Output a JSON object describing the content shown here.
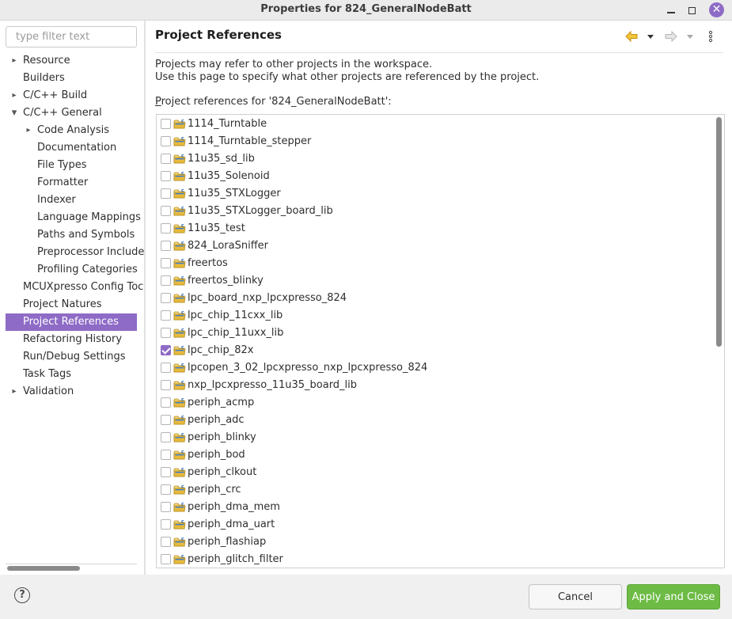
{
  "window": {
    "title": "Properties for 824_GeneralNodeBatt"
  },
  "left_panel": {
    "filter_placeholder": "type filter text",
    "tree": [
      {
        "label": "Resource",
        "level": 0,
        "expandable": true,
        "expanded": false
      },
      {
        "label": "Builders",
        "level": 0,
        "expandable": false
      },
      {
        "label": "C/C++ Build",
        "level": 0,
        "expandable": true,
        "expanded": false
      },
      {
        "label": "C/C++ General",
        "level": 0,
        "expandable": true,
        "expanded": true
      },
      {
        "label": "Code Analysis",
        "level": 1,
        "expandable": true,
        "expanded": false
      },
      {
        "label": "Documentation",
        "level": 1,
        "expandable": false
      },
      {
        "label": "File Types",
        "level": 1,
        "expandable": false
      },
      {
        "label": "Formatter",
        "level": 1,
        "expandable": false
      },
      {
        "label": "Indexer",
        "level": 1,
        "expandable": false
      },
      {
        "label": "Language Mappings",
        "level": 1,
        "expandable": false
      },
      {
        "label": "Paths and Symbols",
        "level": 1,
        "expandable": false
      },
      {
        "label": "Preprocessor Include",
        "level": 1,
        "expandable": false
      },
      {
        "label": "Profiling Categories",
        "level": 1,
        "expandable": false
      },
      {
        "label": "MCUXpresso Config Toc",
        "level": 0,
        "expandable": false
      },
      {
        "label": "Project Natures",
        "level": 0,
        "expandable": false
      },
      {
        "label": "Project References",
        "level": 0,
        "expandable": false,
        "selected": true
      },
      {
        "label": "Refactoring History",
        "level": 0,
        "expandable": false
      },
      {
        "label": "Run/Debug Settings",
        "level": 0,
        "expandable": false
      },
      {
        "label": "Task Tags",
        "level": 0,
        "expandable": false
      },
      {
        "label": "Validation",
        "level": 0,
        "expandable": true,
        "expanded": false
      }
    ]
  },
  "main": {
    "title": "Project References",
    "description_line1": "Projects may refer to other projects in the workspace.",
    "description_line2": "Use this page to specify what other projects are referenced by the project.",
    "list_label_accel": "P",
    "list_label_rest": "roject references for '824_GeneralNodeBatt':",
    "projects": [
      {
        "name": "1114_Turntable",
        "checked": false
      },
      {
        "name": "1114_Turntable_stepper",
        "checked": false
      },
      {
        "name": "11u35_sd_lib",
        "checked": false
      },
      {
        "name": "11u35_Solenoid",
        "checked": false
      },
      {
        "name": "11u35_STXLogger",
        "checked": false
      },
      {
        "name": "11u35_STXLogger_board_lib",
        "checked": false
      },
      {
        "name": "11u35_test",
        "checked": false
      },
      {
        "name": "824_LoraSniffer",
        "checked": false
      },
      {
        "name": "freertos",
        "checked": false
      },
      {
        "name": "freertos_blinky",
        "checked": false
      },
      {
        "name": "lpc_board_nxp_lpcxpresso_824",
        "checked": false
      },
      {
        "name": "lpc_chip_11cxx_lib",
        "checked": false
      },
      {
        "name": "lpc_chip_11uxx_lib",
        "checked": false
      },
      {
        "name": "lpc_chip_82x",
        "checked": true
      },
      {
        "name": "lpcopen_3_02_lpcxpresso_nxp_lpcxpresso_824",
        "checked": false
      },
      {
        "name": "nxp_lpcxpresso_11u35_board_lib",
        "checked": false
      },
      {
        "name": "periph_acmp",
        "checked": false
      },
      {
        "name": "periph_adc",
        "checked": false
      },
      {
        "name": "periph_blinky",
        "checked": false
      },
      {
        "name": "periph_bod",
        "checked": false
      },
      {
        "name": "periph_clkout",
        "checked": false
      },
      {
        "name": "periph_crc",
        "checked": false
      },
      {
        "name": "periph_dma_mem",
        "checked": false
      },
      {
        "name": "periph_dma_uart",
        "checked": false
      },
      {
        "name": "periph_flashiap",
        "checked": false
      },
      {
        "name": "periph_glitch_filter",
        "checked": false
      }
    ]
  },
  "buttons": {
    "cancel": "Cancel",
    "apply_close": "Apply and Close",
    "help": "?"
  },
  "colors": {
    "accent": "#8e6bc6",
    "apply_button": "#6dbb45",
    "nav_back_arrow": "#e8b22b"
  },
  "icons": {
    "back": "back-arrow-icon",
    "forward": "forward-arrow-icon",
    "menu": "vertical-ellipsis-icon",
    "project": "c-project-folder-icon"
  }
}
